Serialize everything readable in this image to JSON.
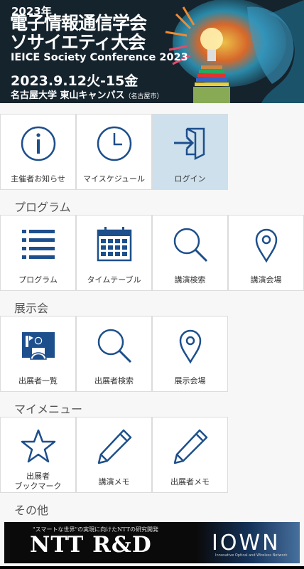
{
  "banner": {
    "year": "2023年",
    "title_line1": "電子情報通信学会",
    "title_line2": "ソサイエティ大会",
    "title_en": "IEICE Society Conference 2023",
    "date": "2023.9.12火-15金",
    "venue": "名古屋大学 東山キャンパス",
    "venue_city": "（名古屋市）"
  },
  "top_menu": [
    {
      "label": "主催者お知らせ",
      "icon": "info-icon"
    },
    {
      "label": "マイスケジュール",
      "icon": "clock-icon"
    },
    {
      "label": "ログイン",
      "icon": "login-icon",
      "active": true
    }
  ],
  "sections": {
    "program": {
      "title": "プログラム",
      "items": [
        {
          "label": "プログラム",
          "icon": "list-icon"
        },
        {
          "label": "タイムテーブル",
          "icon": "calendar-icon"
        },
        {
          "label": "講演検索",
          "icon": "search-icon"
        },
        {
          "label": "講演会場",
          "icon": "map-pin-icon"
        }
      ]
    },
    "exhibition": {
      "title": "展示会",
      "items": [
        {
          "label": "出展者一覧",
          "icon": "presenter-icon"
        },
        {
          "label": "出展者検索",
          "icon": "search-icon"
        },
        {
          "label": "展示会場",
          "icon": "map-pin-icon"
        }
      ]
    },
    "my_menu": {
      "title": "マイメニュー",
      "items": [
        {
          "label_line1": "出展者",
          "label_line2": "ブックマーク",
          "icon": "star-icon"
        },
        {
          "label": "講演メモ",
          "icon": "pencil-icon"
        },
        {
          "label": "出展者メモ",
          "icon": "pencil-icon"
        }
      ]
    },
    "other": {
      "title": "その他"
    }
  },
  "ad": {
    "tagline": "\"スマートな世界\"の実現に向けたNTTの研究開発",
    "brand": "NTT R&D",
    "logo": "IOWN",
    "logo_sub": "Innovative Optical and Wireless Network"
  },
  "colors": {
    "icon_blue": "#1d4f8c",
    "active_tile": "#cde0ec",
    "banner_bg": "#15232d"
  }
}
